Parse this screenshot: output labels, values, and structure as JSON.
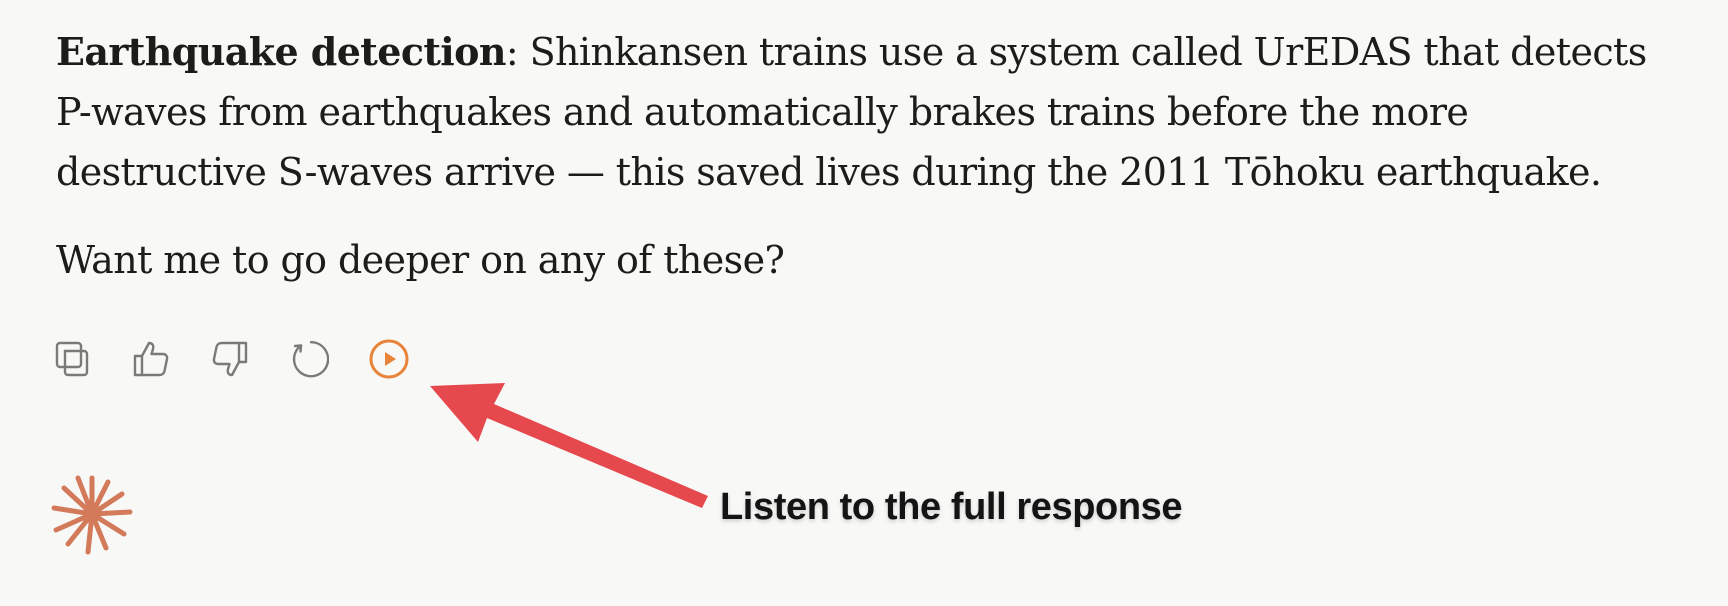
{
  "message": {
    "paragraph1_bold": "Earthquake detection",
    "paragraph1_text": ": Shinkansen trains use a system called UrEDAS that detects P-waves from earthquakes and automatically brakes trains before the more destructive S-waves arrive — this saved lives during the 2011 Tōhoku earthquake.",
    "paragraph2_text": "Want me to go deeper on any of these?"
  },
  "actions": [
    {
      "icon": "copy-icon"
    },
    {
      "icon": "thumbs-up-icon"
    },
    {
      "icon": "thumbs-down-icon"
    },
    {
      "icon": "retry-icon"
    },
    {
      "icon": "play-icon"
    }
  ],
  "annotation": {
    "callout_text": "Listen to the full response",
    "arrow_color": "#e5484d"
  },
  "colors": {
    "accent": "#e8833a",
    "icon_gray": "#7a7a78",
    "logo": "#d27a5a",
    "background": "#f8f8f6"
  }
}
